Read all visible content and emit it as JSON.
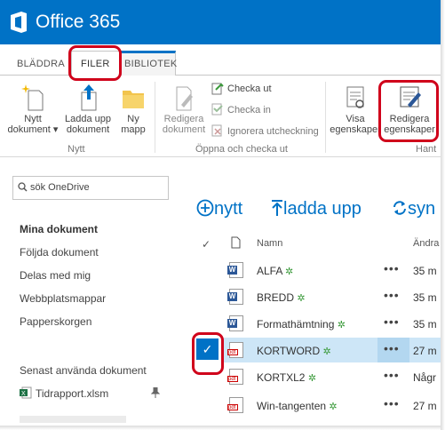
{
  "app": {
    "title": "Office 365"
  },
  "tabs": [
    {
      "label": "BLÄDDRA"
    },
    {
      "label": "FILER"
    },
    {
      "label": "BIBLIOTEK"
    }
  ],
  "ribbon": {
    "new_doc": "Nytt dokument",
    "new_doc_l1": "Nytt",
    "new_doc_l2": "dokument",
    "upload_l1": "Ladda upp",
    "upload_l2": "dokument",
    "new_folder_l1": "Ny",
    "new_folder_l2": "mapp",
    "group_new": "Nytt",
    "edit_l1": "Redigera",
    "edit_l2": "dokument",
    "checkout": "Checka ut",
    "checkin": "Checka in",
    "discard_checkout": "Ignorera utcheckning",
    "group_open": "Öppna och checka ut",
    "view_props_l1": "Visa",
    "view_props_l2": "egenskaper",
    "edit_props_l1": "Redigera",
    "edit_props_l2": "egenskaper",
    "group_manage": "Hant"
  },
  "search": {
    "placeholder": "sök OneDrive"
  },
  "nav": {
    "items": [
      {
        "label": "Mina dokument"
      },
      {
        "label": "Följda dokument"
      },
      {
        "label": "Delas med mig"
      },
      {
        "label": "Webbplatsmappar"
      },
      {
        "label": "Papperskorgen"
      }
    ],
    "recent_title": "Senast använda dokument",
    "recent": [
      {
        "label": "Tidrapport.xlsm"
      }
    ]
  },
  "commands": {
    "new": "nytt",
    "upload": "ladda upp",
    "sync": "syn"
  },
  "list": {
    "col_name": "Namn",
    "col_modified": "Ändra",
    "rows": [
      {
        "name": "ALFA",
        "type": "word",
        "modified": "35 m"
      },
      {
        "name": "BREDD",
        "type": "word",
        "modified": "35 m"
      },
      {
        "name": "Formathämtning",
        "type": "word",
        "modified": "35 m"
      },
      {
        "name": "KORTWORD",
        "type": "pdf",
        "modified": "27 m",
        "selected": true
      },
      {
        "name": "KORTXL2",
        "type": "pdf",
        "modified": "Någr"
      },
      {
        "name": "Win-tangenten",
        "type": "pdf",
        "modified": "27 m"
      }
    ]
  },
  "colors": {
    "brand": "#0072c6",
    "highlight": "#d0021b",
    "selected_row": "#cde6f7"
  }
}
